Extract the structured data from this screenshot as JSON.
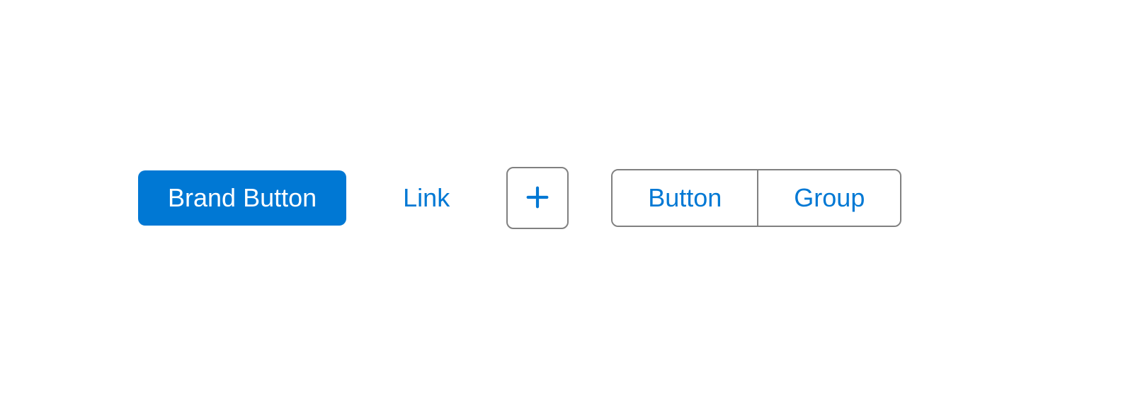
{
  "buttons": {
    "brand_label": "Brand Button",
    "link_label": "Link",
    "icon_name": "plus-icon",
    "group": {
      "item1_label": "Button",
      "item2_label": "Group"
    }
  },
  "colors": {
    "brand": "#0078d4",
    "border": "#808080",
    "white": "#ffffff"
  }
}
